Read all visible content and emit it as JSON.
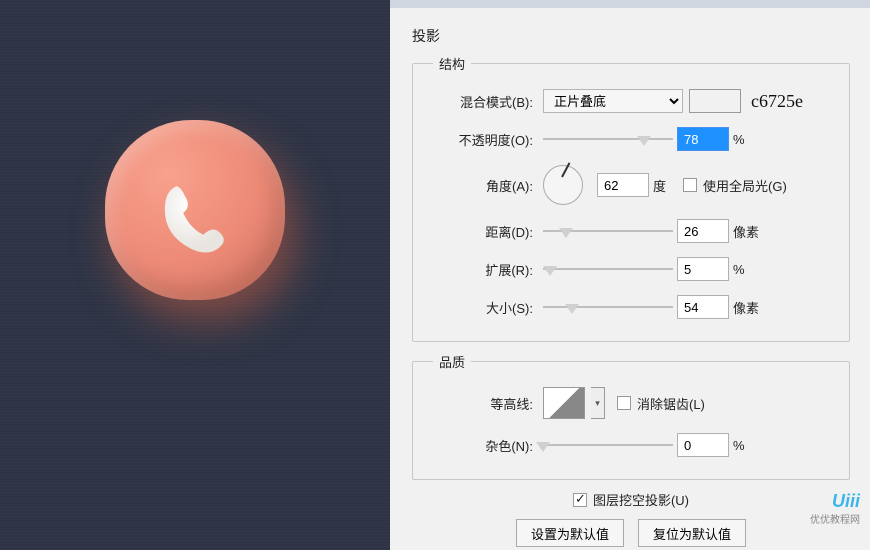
{
  "panel": {
    "title": "投影",
    "structure": {
      "legend": "结构",
      "blend_mode_label": "混合模式(B):",
      "blend_mode_value": "正片叠底",
      "color_hex": "c6725e",
      "color_swatch": "#c6725e",
      "opacity_label": "不透明度(O):",
      "opacity_value": "78",
      "opacity_unit": "%",
      "opacity_slider_pos": "78%",
      "angle_label": "角度(A):",
      "angle_value": "62",
      "angle_unit": "度",
      "global_light_label": "使用全局光(G)",
      "distance_label": "距离(D):",
      "distance_value": "26",
      "distance_unit": "像素",
      "distance_slider_pos": "18%",
      "spread_label": "扩展(R):",
      "spread_value": "5",
      "spread_unit": "%",
      "spread_slider_pos": "5%",
      "size_label": "大小(S):",
      "size_value": "54",
      "size_unit": "像素",
      "size_slider_pos": "22%"
    },
    "quality": {
      "legend": "品质",
      "contour_label": "等高线:",
      "antialias_label": "消除锯齿(L)",
      "noise_label": "杂色(N):",
      "noise_value": "0",
      "noise_unit": "%",
      "noise_slider_pos": "0%"
    },
    "knockout_label": "图层挖空投影(U)",
    "btn_default": "设置为默认值",
    "btn_reset": "复位为默认值"
  },
  "watermark": {
    "main": "Uiii",
    "sub": "优优教程网"
  }
}
